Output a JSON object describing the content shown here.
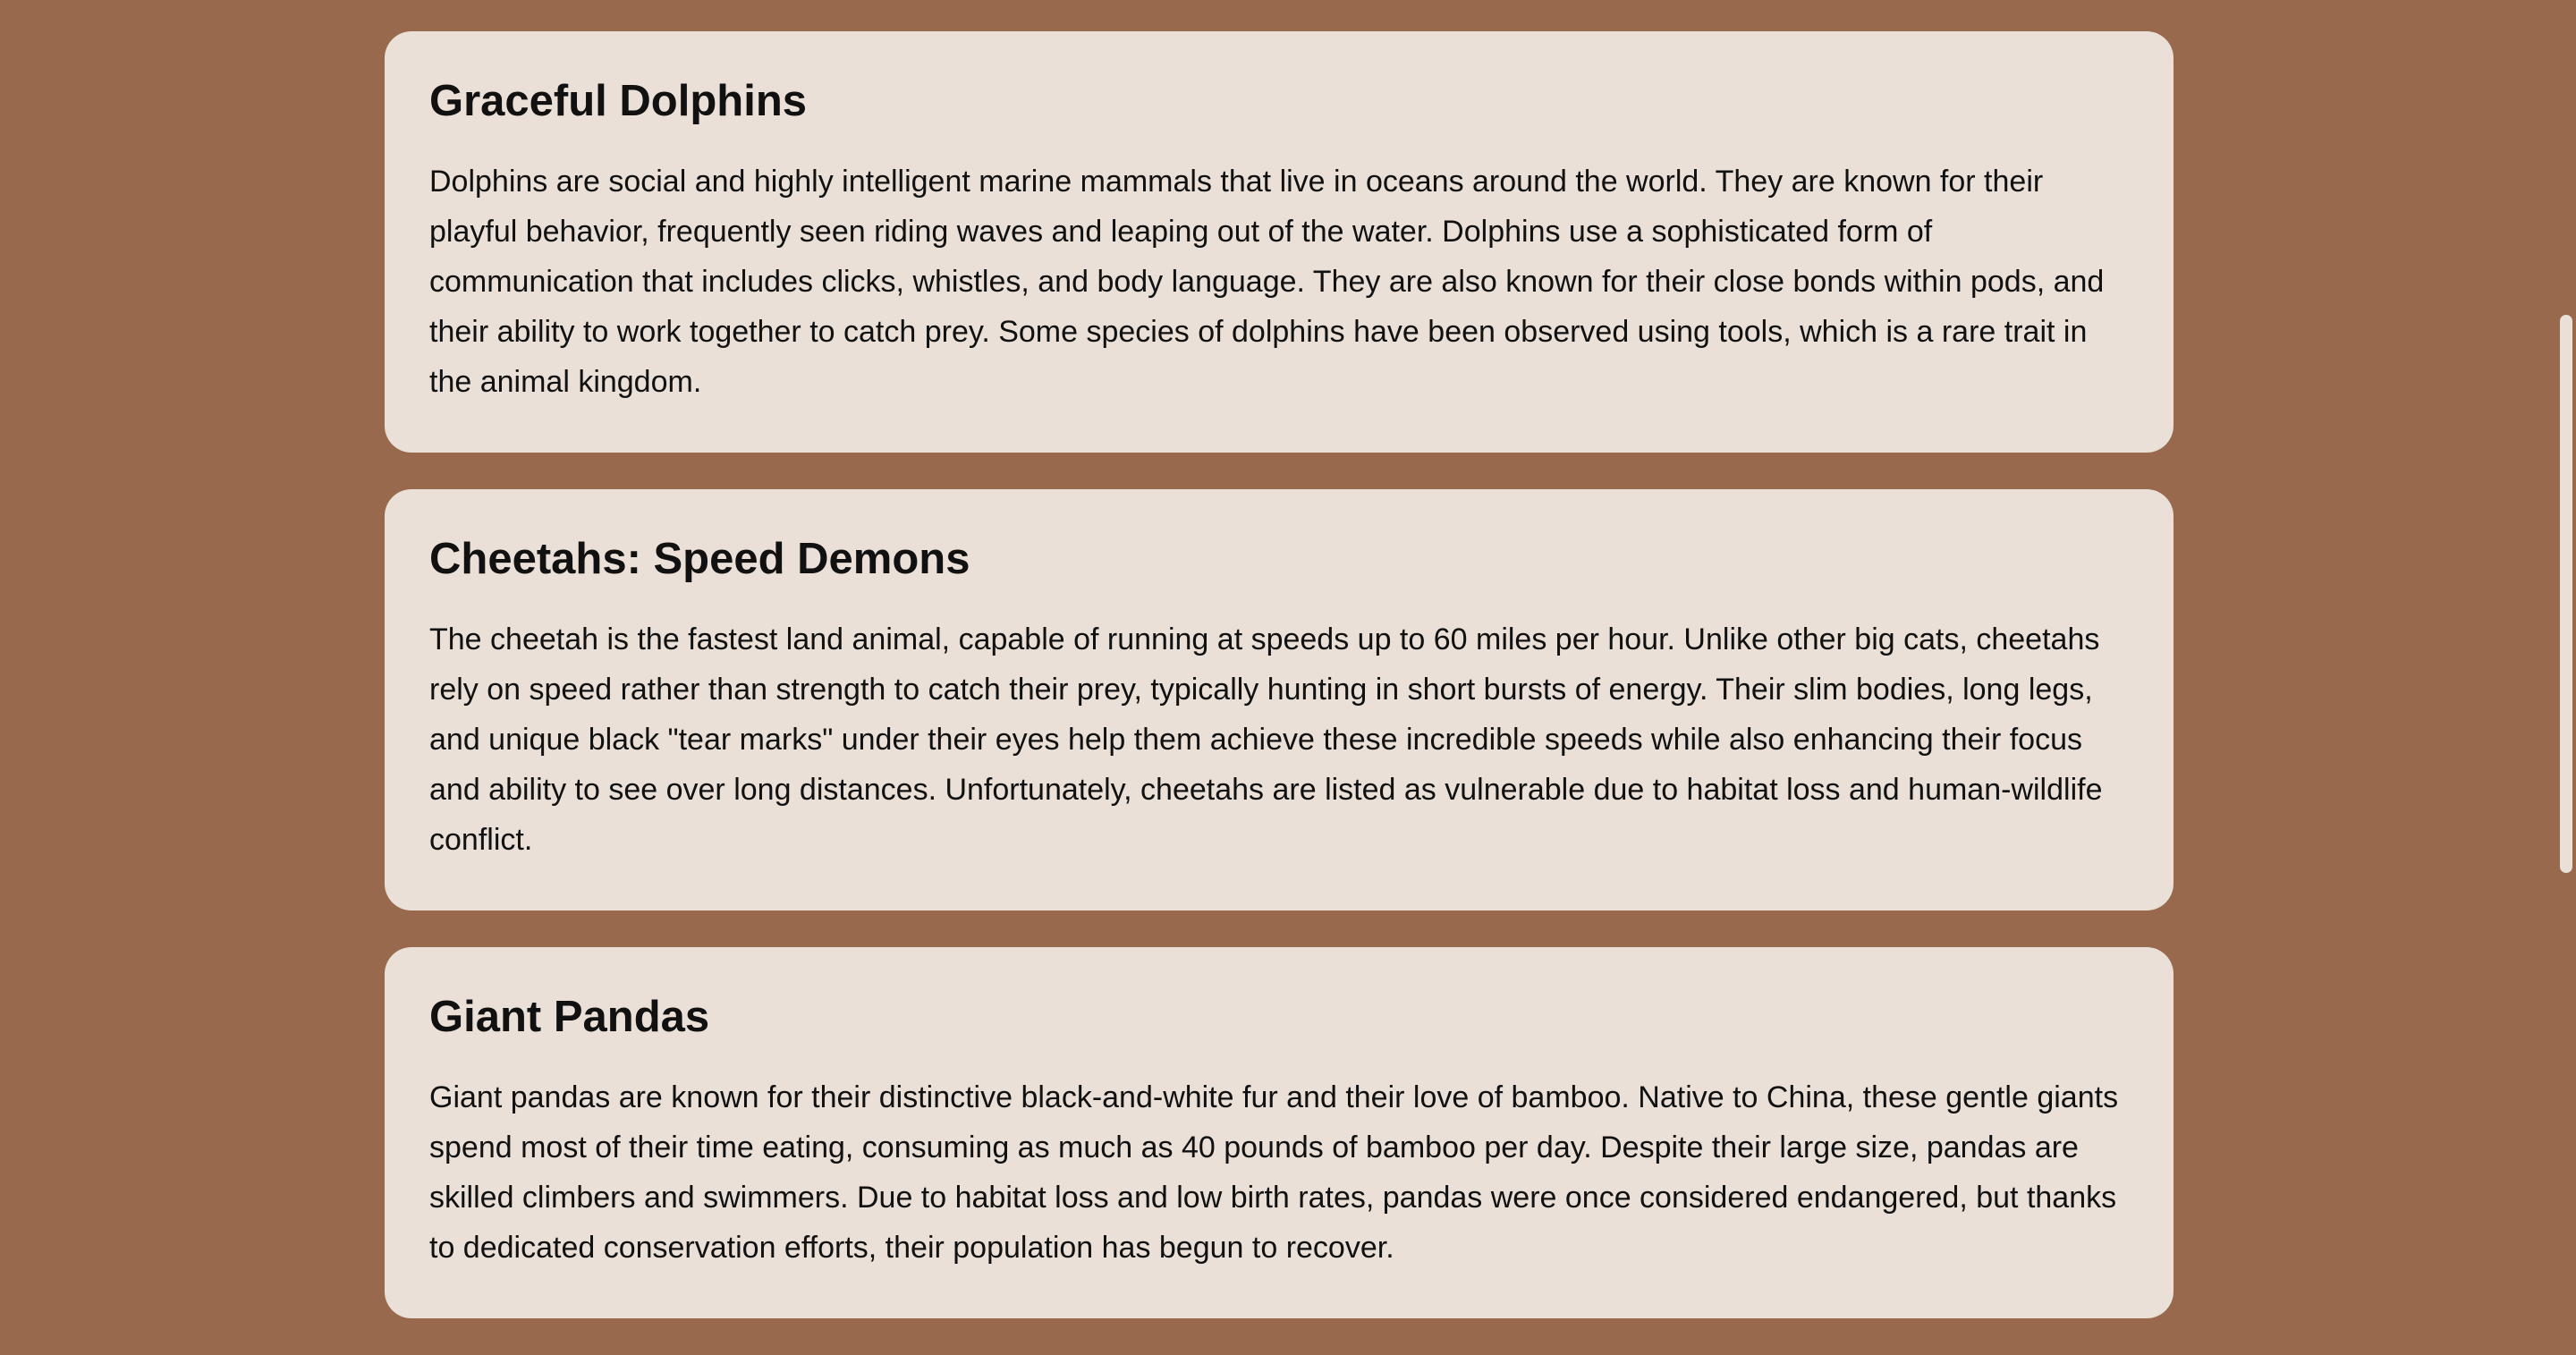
{
  "colors": {
    "background": "#98694d",
    "card": "#eae0d7",
    "text": "#111111"
  },
  "cards": [
    {
      "title": "Graceful Dolphins",
      "body": "Dolphins are social and highly intelligent marine mammals that live in oceans around the world. They are known for their playful behavior, frequently seen riding waves and leaping out of the water. Dolphins use a sophisticated form of communication that includes clicks, whistles, and body language. They are also known for their close bonds within pods, and their ability to work together to catch prey. Some species of dolphins have been observed using tools, which is a rare trait in the animal kingdom."
    },
    {
      "title": "Cheetahs: Speed Demons",
      "body": "The cheetah is the fastest land animal, capable of running at speeds up to 60 miles per hour. Unlike other big cats, cheetahs rely on speed rather than strength to catch their prey, typically hunting in short bursts of energy. Their slim bodies, long legs, and unique black \"tear marks\" under their eyes help them achieve these incredible speeds while also enhancing their focus and ability to see over long distances. Unfortunately, cheetahs are listed as vulnerable due to habitat loss and human-wildlife conflict."
    },
    {
      "title": "Giant Pandas",
      "body": "Giant pandas are known for their distinctive black-and-white fur and their love of bamboo. Native to China, these gentle giants spend most of their time eating, consuming as much as 40 pounds of bamboo per day. Despite their large size, pandas are skilled climbers and swimmers. Due to habitat loss and low birth rates, pandas were once considered endangered, but thanks to dedicated conservation efforts, their population has begun to recover."
    }
  ]
}
